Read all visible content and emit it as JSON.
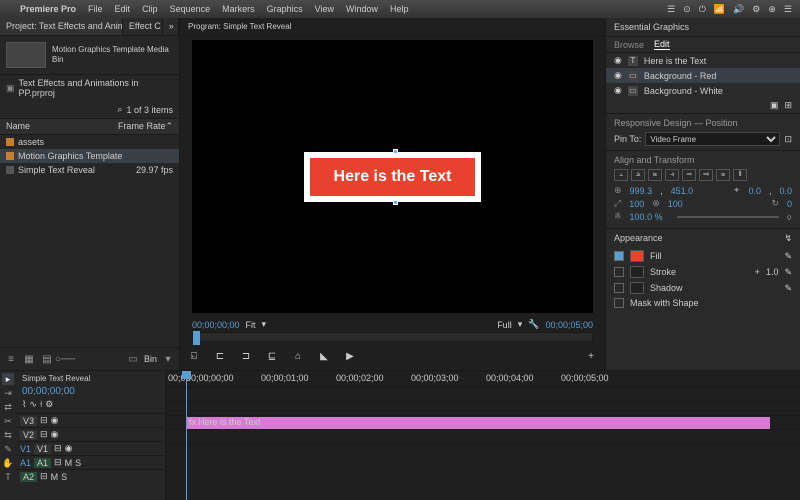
{
  "menubar": {
    "apple": "",
    "app": "Premiere Pro",
    "items": [
      "File",
      "Edit",
      "Clip",
      "Sequence",
      "Markers",
      "Graphics",
      "View",
      "Window",
      "Help"
    ],
    "sys": [
      "☰",
      "⊙",
      "⏻",
      "📶",
      "🔊",
      "⚙",
      "⊕",
      "☰"
    ]
  },
  "project": {
    "tab1": "Project: Text Effects and Animations in PP",
    "tab2": "Effect C…",
    "bin_title": "Motion Graphics Template Media",
    "bin_sub": "Bin",
    "folder": "Text Effects and Animations in PP.prproj",
    "count": "1 of 3 items",
    "head_name": "Name",
    "head_rate": "Frame Rate",
    "items": [
      {
        "label": "assets",
        "rate": ""
      },
      {
        "label": "Motion Graphics Template",
        "rate": ""
      },
      {
        "label": "Simple Text Reveal",
        "rate": "29.97 fps"
      }
    ],
    "foot_bin": "Bin"
  },
  "program": {
    "title": "Program: Simple Text Reveal",
    "overlay_text": "Here is the Text",
    "tc_left": "00;00;00;00",
    "fit": "Fit",
    "full": "Full",
    "tc_right": "00;00;05;00",
    "transport": [
      "⍇",
      "⊏",
      "⊐",
      "⊑",
      "⌂",
      "◣",
      "▶"
    ]
  },
  "eg": {
    "title": "Essential Graphics",
    "tabs": [
      "Browse",
      "Edit"
    ],
    "layers": [
      {
        "icon": "T",
        "label": "Here is the Text"
      },
      {
        "icon": "▭",
        "label": "Background - Red"
      },
      {
        "icon": "▭",
        "label": "Background - White"
      }
    ],
    "responsive": "Responsive Design — Position",
    "pin_label": "Pin To:",
    "pin_value": "Video Frame",
    "align_h": "Align and Transform",
    "pos_x": "999.3",
    "pos_y": "451.0",
    "anchor_x": "0.0",
    "anchor_y": "0.0",
    "scale": "100",
    "scale2": "100",
    "rot": "0",
    "opacity": "100.0 %",
    "appearance": "Appearance",
    "fill": "Fill",
    "stroke": "Stroke",
    "stroke_w": "1.0",
    "shadow": "Shadow",
    "mask": "Mask with Shape"
  },
  "timeline": {
    "title": "Simple Text Reveal",
    "tc": "00;00;00;00",
    "marks": [
      "00;00",
      "00;00;00;00",
      "00;00;01;00",
      "00;00;02;00",
      "00;00;03;00",
      "00;00;04;00",
      "00;00;05;00"
    ],
    "v": [
      "V3",
      "V2",
      "V1"
    ],
    "a": [
      "A1",
      "A2"
    ],
    "clip": "Here is the Text"
  },
  "colors": {
    "accent": "#5a9fd4",
    "red": "#e8422f"
  }
}
